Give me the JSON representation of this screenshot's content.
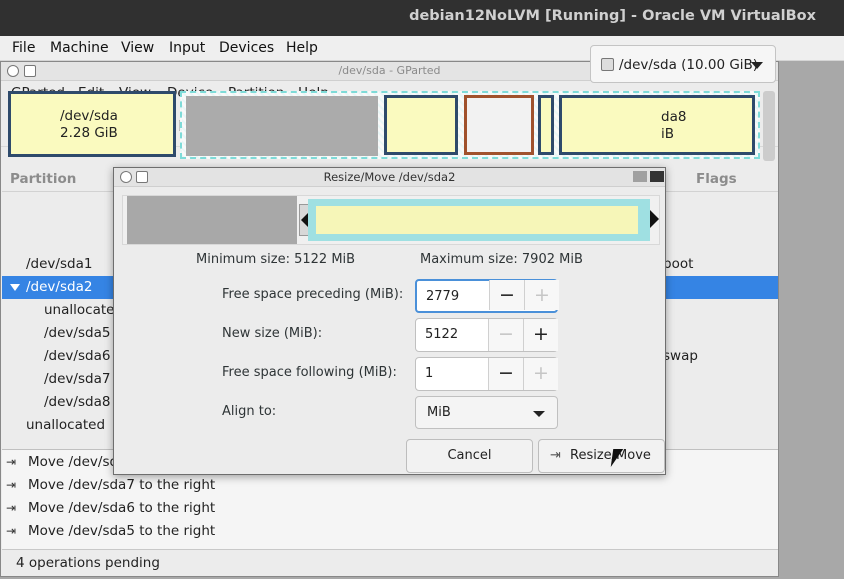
{
  "vbox": {
    "title": "debian12NoLVM [Running] - Oracle VM VirtualBox",
    "menu": [
      "File",
      "Machine",
      "View",
      "Input",
      "Devices",
      "Help"
    ]
  },
  "gparted": {
    "title": "/dev/sda - GParted",
    "menu": [
      "GParted",
      "Edit",
      "View",
      "Device",
      "Partition",
      "Help"
    ],
    "toolbar_icons": [
      "new-icon",
      "delete-icon",
      "resize-move-icon",
      "copy-icon",
      "paste-icon",
      "undo-icon",
      "apply-icon"
    ],
    "device": "/dev/sda (10.00 GiB)",
    "map": {
      "first_name": "/dev/sda",
      "first_size": "2.28 GiB",
      "last_name": "da8",
      "last_size": "iB"
    },
    "columns": {
      "partition": "Partition",
      "flags": "Flags"
    },
    "partitions": [
      {
        "name": "/dev/sda1",
        "flag": "boot"
      },
      {
        "name": "/dev/sda2",
        "flag": ""
      },
      {
        "name": "unallocated",
        "flag": ""
      },
      {
        "name": "/dev/sda5",
        "flag": ""
      },
      {
        "name": "/dev/sda6",
        "flag": "swap"
      },
      {
        "name": "/dev/sda7",
        "flag": ""
      },
      {
        "name": "/dev/sda8",
        "flag": ""
      },
      {
        "name": "unallocated",
        "flag": ""
      }
    ],
    "operations": [
      "Move /dev/sda8 to the right",
      "Move /dev/sda7 to the right",
      "Move /dev/sda6 to the right",
      "Move /dev/sda5 to the right"
    ],
    "status": "4 operations pending"
  },
  "dialog": {
    "title": "Resize/Move /dev/sda2",
    "min_size": "Minimum size: 5122 MiB",
    "max_size": "Maximum size: 7902 MiB",
    "fields": {
      "preceding_label": "Free space preceding (MiB):",
      "preceding_value": "2779",
      "new_size_label": "New size (MiB):",
      "new_size_value": "5122",
      "following_label": "Free space following (MiB):",
      "following_value": "1",
      "align_label": "Align to:",
      "align_value": "MiB"
    },
    "cancel": "Cancel",
    "resize": "Resize/Move",
    "spin_minus": "−",
    "spin_plus": "+"
  }
}
